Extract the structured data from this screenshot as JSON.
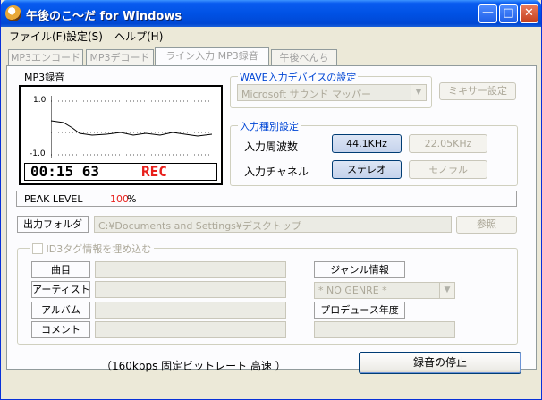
{
  "window": {
    "title": "午後のこ～だ for Windows"
  },
  "menu": [
    "ファイル(F)",
    "設定(S)",
    "ヘルプ(H)"
  ],
  "tabs": [
    "MP3エンコード",
    "MP3デコード",
    "ライン入力 MP3録音",
    "午後べんち"
  ],
  "recorder": {
    "label": "MP3録音",
    "scale_top": "1.0",
    "scale_bottom": "-1.0",
    "time": "00:15 63",
    "status": "REC",
    "status_color": "#e8201c"
  },
  "wave_device": {
    "group_title": "WAVE入力デバイスの設定",
    "device": "Microsoft サウンド マッパー",
    "mixer_button": "ミキサー設定"
  },
  "input_type": {
    "group_title": "入力種別設定",
    "frequency_label": "入力周波数",
    "freq_44": "44.1KHz",
    "freq_22": "22.05KHz",
    "channel_label": "入力チャネル",
    "stereo": "ステレオ",
    "mono": "モノラル"
  },
  "peak": {
    "label": "PEAK LEVEL",
    "value": "100",
    "unit": "%",
    "value_color": "#e8201c"
  },
  "output": {
    "folder_label": "出力フォルダ",
    "path": "C:¥Documents and Settings¥デスクトップ",
    "browse_button": "参照"
  },
  "id3": {
    "checkbox_label": "ID3タグ情報を埋め込む",
    "title_label": "曲目",
    "artist_label": "アーティスト",
    "album_label": "アルバム",
    "comment_label": "コメント",
    "genre_label": "ジャンル情報",
    "genre_value": "* NO GENRE *",
    "year_label": "プロデュース年度"
  },
  "footer": {
    "bitrate_text": "（160kbps  固定ビットレート 高速 ）",
    "stop_button": "録音の停止"
  }
}
